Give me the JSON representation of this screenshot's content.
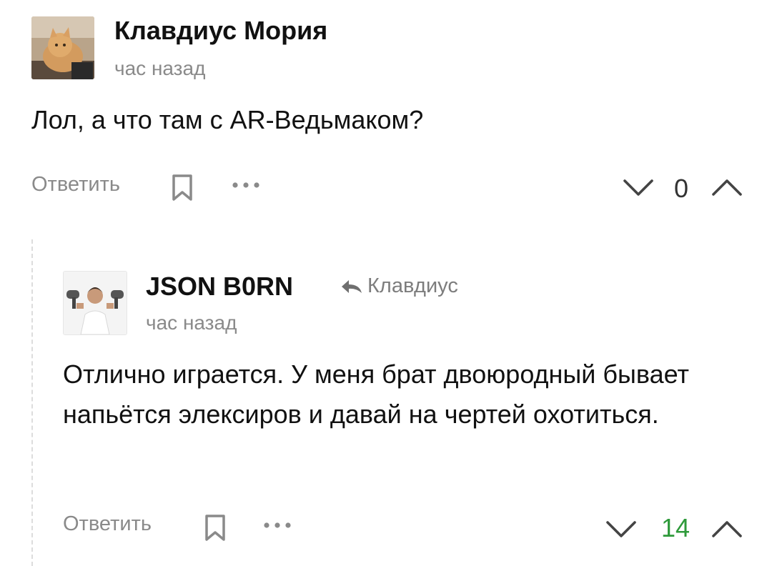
{
  "comments": [
    {
      "author": "Клавдиус Мория",
      "time": "час назад",
      "text": "Лол, а что там с AR-Ведьмаком?",
      "actions": {
        "reply_label": "Ответить"
      },
      "rating": "0",
      "rating_color": "#333333",
      "avatar_icon": "cat-avatar"
    },
    {
      "author": "JSON B0RN",
      "reply_to": "Клавдиус",
      "time": "час назад",
      "text": "Отлично играется. У меня брат двоюродный бывает напьётся элексиров и давай на чертей охотиться.",
      "actions": {
        "reply_label": "Ответить"
      },
      "rating": "14",
      "rating_color": "#2e9a3a",
      "avatar_icon": "man-with-hairdryers-avatar"
    }
  ],
  "colors": {
    "muted": "#8a8a8a",
    "positive": "#2e9a3a"
  }
}
